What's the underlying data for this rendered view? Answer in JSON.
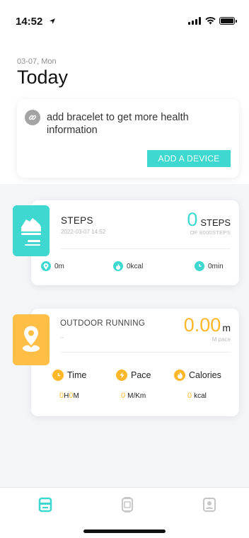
{
  "status_bar": {
    "time": "14:52",
    "location_arrow": "location-arrow-icon",
    "signal": "signal-icon",
    "wifi": "wifi-icon",
    "battery": "battery-icon"
  },
  "header": {
    "date": "03-07, Mon",
    "title": "Today"
  },
  "bracelet_card": {
    "icon": "link-icon",
    "message": "add bracelet to get more health information",
    "button_label": "ADD A DEVICE"
  },
  "steps_card": {
    "icon": "sneaker-icon",
    "title": "STEPS",
    "timestamp": "2022-03-07 14:52",
    "value": "0",
    "unit": "STEPS",
    "goal": "OF 8000STEPS",
    "metrics": [
      {
        "icon": "location-pin-icon",
        "value": "0m"
      },
      {
        "icon": "flame-icon",
        "value": "0kcal"
      },
      {
        "icon": "clock-icon",
        "value": "0min"
      }
    ]
  },
  "run_card": {
    "icon": "map-pin-icon",
    "title": "OUTDOOR RUNNING",
    "subtitle": "--",
    "value": "0.00",
    "unit": "m",
    "value_caption": "M pace",
    "metrics": [
      {
        "icon": "clock-icon",
        "label": "Time",
        "value_parts": [
          "0",
          "H",
          "0",
          "M"
        ]
      },
      {
        "icon": "lightning-icon",
        "label": "Pace",
        "num": "0",
        "unit": "M/Km"
      },
      {
        "icon": "flame-icon",
        "label": "Calories",
        "num": "0",
        "unit": "kcal"
      }
    ]
  },
  "tab_bar": {
    "tabs": [
      {
        "icon": "today-tab-icon",
        "active": true
      },
      {
        "icon": "device-tab-icon",
        "active": false
      },
      {
        "icon": "profile-tab-icon",
        "active": false
      }
    ]
  },
  "colors": {
    "accent_teal": "#3fd8d0",
    "accent_orange": "#ffb72a",
    "tab_inactive": "#c8c8c8"
  }
}
